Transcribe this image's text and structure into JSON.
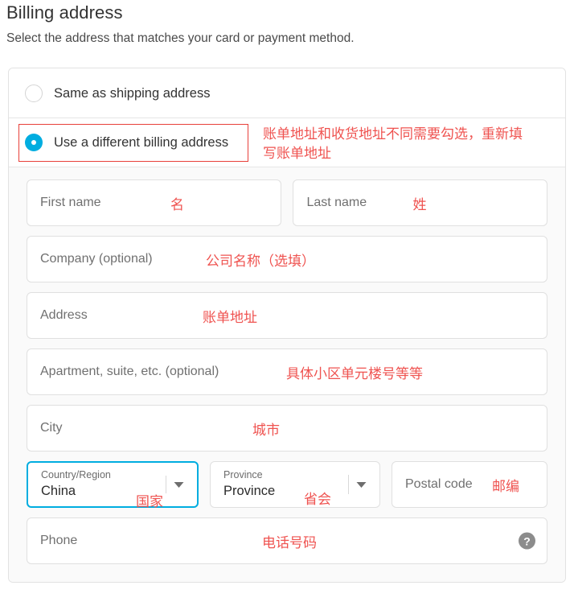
{
  "header": {
    "title": "Billing address",
    "subtitle": "Select the address that matches your card or payment method."
  },
  "colors": {
    "accent": "#00ade0",
    "annotation_red": "#ef5350",
    "annotation_box_red": "#e8403a",
    "field_border": "#e0e0e0",
    "body_background": "#fafafa"
  },
  "options": [
    {
      "label": "Same as shipping address",
      "selected": false,
      "annotation": ""
    },
    {
      "label": "Use a different billing address",
      "selected": true,
      "annotation": "账单地址和收货地址不同需要勾选，重新填\n写账单地址"
    }
  ],
  "fields": {
    "first_name": {
      "placeholder": "First name",
      "value": "",
      "annotation": "名"
    },
    "last_name": {
      "placeholder": "Last name",
      "value": "",
      "annotation": "姓"
    },
    "company": {
      "placeholder": "Company (optional)",
      "value": "",
      "annotation": "公司名称（选填）"
    },
    "address": {
      "placeholder": "Address",
      "value": "",
      "annotation": "账单地址"
    },
    "apartment": {
      "placeholder": "Apartment, suite, etc. (optional)",
      "value": "",
      "annotation": "具体小区单元楼号等等"
    },
    "city": {
      "placeholder": "City",
      "value": "",
      "annotation": "城市"
    },
    "country": {
      "label": "Country/Region",
      "value": "China",
      "annotation": "国家",
      "focused": true
    },
    "province": {
      "label": "Province",
      "value": "Province",
      "annotation": "省会",
      "focused": false
    },
    "postal_code": {
      "placeholder": "Postal code",
      "value": "",
      "annotation": "邮编"
    },
    "phone": {
      "placeholder": "Phone",
      "value": "",
      "annotation": "电话号码",
      "help_icon": "?"
    }
  }
}
